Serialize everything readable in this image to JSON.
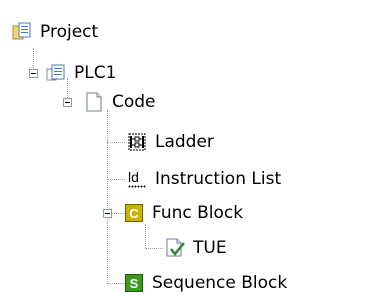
{
  "tree": {
    "root": {
      "label": "Project",
      "icon": "project-icon"
    },
    "plc": {
      "label": "PLC1",
      "icon": "plc-icon",
      "expanded": true
    },
    "code": {
      "label": "Code",
      "icon": "document-icon",
      "expanded": true
    },
    "ladder": {
      "label": "Ladder",
      "icon": "ladder-diagram-icon"
    },
    "instruction_list": {
      "label": "Instruction List",
      "icon": "instruction-list-icon",
      "icon_text": "ld"
    },
    "func_block": {
      "label": "Func Block",
      "icon": "function-block-icon",
      "icon_letter": "C",
      "expanded": true
    },
    "tue": {
      "label": "TUE",
      "icon": "checked-document-icon"
    },
    "sequence_block": {
      "label": "Sequence Block",
      "icon": "sequence-block-icon",
      "icon_letter": "S"
    }
  },
  "colors": {
    "func_block_icon": "#c8b400",
    "sequence_block_icon": "#3c9a1e",
    "tree_lines": "#a0a0a0",
    "expander_border": "#8f9ba8"
  }
}
